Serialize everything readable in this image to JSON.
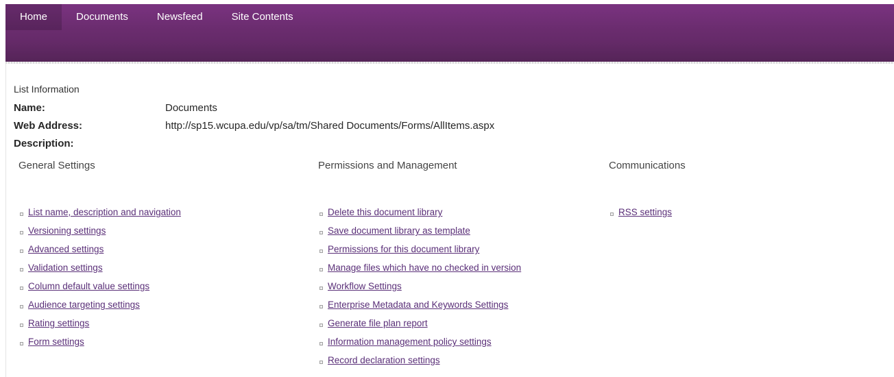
{
  "nav": {
    "items": [
      {
        "label": "Home"
      },
      {
        "label": "Documents"
      },
      {
        "label": "Newsfeed"
      },
      {
        "label": "Site Contents"
      }
    ]
  },
  "list_info": {
    "title": "List Information",
    "name_label": "Name:",
    "name_value": "Documents",
    "web_address_label": "Web Address:",
    "web_address_value": "http://sp15.wcupa.edu/vp/sa/tm/Shared Documents/Forms/AllItems.aspx",
    "description_label": "Description:"
  },
  "sections": {
    "general": {
      "title": "General Settings",
      "links": [
        "List name, description and navigation",
        "Versioning settings",
        "Advanced settings",
        "Validation settings",
        "Column default value settings",
        "Audience targeting settings",
        "Rating settings",
        "Form settings"
      ]
    },
    "permissions": {
      "title": "Permissions and Management",
      "links": [
        "Delete this document library",
        "Save document library as template",
        "Permissions for this document library",
        "Manage files which have no checked in version",
        "Workflow Settings",
        "Enterprise Metadata and Keywords Settings",
        "Generate file plan report",
        "Information management policy settings",
        "Record declaration settings"
      ]
    },
    "communications": {
      "title": "Communications",
      "links": [
        "RSS settings"
      ]
    }
  },
  "colors": {
    "header": "#6a2c6e",
    "link": "#5a2f78"
  }
}
